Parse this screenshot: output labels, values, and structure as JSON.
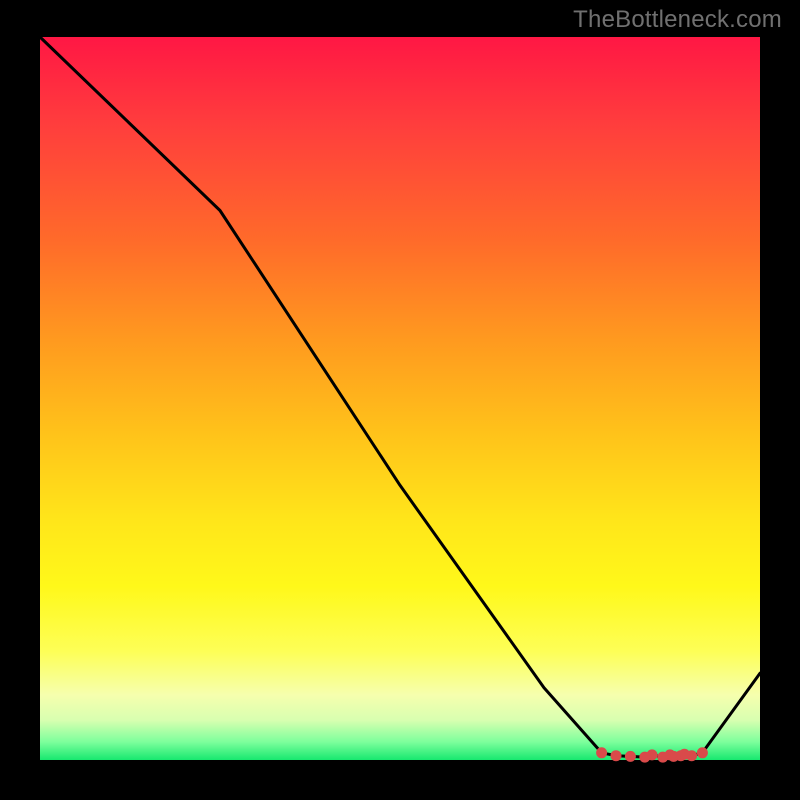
{
  "watermark": "TheBottleneck.com",
  "colors": {
    "page_bg": "#000000",
    "line": "#000000",
    "marker": "#d94a4a",
    "gradient_stops": [
      "#ff1744",
      "#ff3d3d",
      "#ff6a2a",
      "#ff9a1f",
      "#ffc31a",
      "#ffe61a",
      "#fff81a",
      "#fdff57",
      "#f6ffae",
      "#d8ffb0",
      "#7dff9c",
      "#17e86f"
    ]
  },
  "chart_data": {
    "type": "line",
    "x": [
      0.0,
      0.25,
      0.5,
      0.7,
      0.78,
      0.8,
      0.82,
      0.84,
      0.85,
      0.865,
      0.875,
      0.88,
      0.89,
      0.895,
      0.905,
      0.92,
      1.0
    ],
    "values": [
      1.0,
      0.76,
      0.38,
      0.1,
      0.01,
      0.006,
      0.005,
      0.004,
      0.007,
      0.004,
      0.007,
      0.005,
      0.006,
      0.008,
      0.006,
      0.01,
      0.12
    ],
    "title": "",
    "xlabel": "",
    "ylabel": "",
    "xlim": [
      0,
      1
    ],
    "ylim": [
      0,
      1
    ],
    "markers_x": [
      0.78,
      0.8,
      0.82,
      0.84,
      0.85,
      0.865,
      0.875,
      0.88,
      0.89,
      0.895,
      0.905,
      0.92
    ],
    "markers_y": [
      0.01,
      0.006,
      0.005,
      0.004,
      0.007,
      0.004,
      0.007,
      0.005,
      0.006,
      0.008,
      0.006,
      0.01
    ]
  }
}
